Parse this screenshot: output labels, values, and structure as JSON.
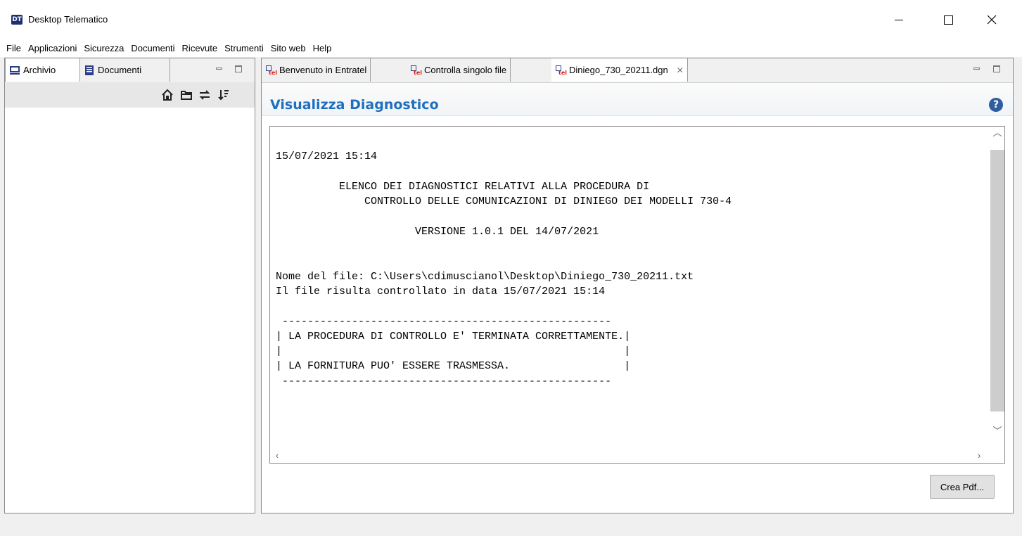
{
  "window": {
    "icon_label": "DT",
    "title": "Desktop Telematico"
  },
  "menu": [
    "File",
    "Applicazioni",
    "Sicurezza",
    "Documenti",
    "Ricevute",
    "Strumenti",
    "Sito web",
    "Help"
  ],
  "left_panel": {
    "tabs": [
      "Archivio",
      "Documenti"
    ],
    "toolbar_icons": [
      "home-icon",
      "folder-icon",
      "sync-icon",
      "sort-icon"
    ]
  },
  "right_panel": {
    "tabs": [
      "Benvenuto in Entratel",
      "Controlla singolo file",
      "Diniego_730_20211.dgn"
    ],
    "active_tab": "Diniego_730_20211.dgn",
    "form_title": "Visualizza Diagnostico",
    "help_symbol": "?",
    "diagnostic_text": "\n15/07/2021 15:14\n\n          ELENCO DEI DIAGNOSTICI RELATIVI ALLA PROCEDURA DI\n              CONTROLLO DELLE COMUNICAZIONI DI DINIEGO DEI MODELLI 730-4\n\n                      VERSIONE 1.0.1 DEL 14/07/2021\n\n\nNome del file: C:\\Users\\cdimuscianol\\Desktop\\Diniego_730_20211.txt\nIl file risulta controllato in data 15/07/2021 15:14\n\n ----------------------------------------------------\n| LA PROCEDURA DI CONTROLLO E' TERMINATA CORRETTAMENTE.|\n|                                                      |\n| LA FORNITURA PUO' ESSERE TRASMESSA.                  |\n ----------------------------------------------------",
    "button_label": "Crea Pdf..."
  }
}
